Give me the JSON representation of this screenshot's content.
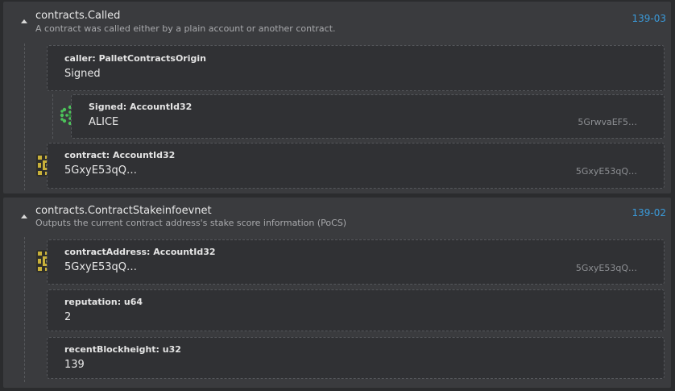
{
  "events": [
    {
      "title": "contracts.Called",
      "description": "A contract was called either by a plain account or another contract.",
      "link": "139-03",
      "params": [
        {
          "label": "caller: PalletContractsOrigin",
          "value": "Signed"
        },
        {
          "label": "Signed: AccountId32",
          "value": "ALICE",
          "address": "5GrwvaEF5…",
          "icon": "identicon-green"
        },
        {
          "label": "contract: AccountId32",
          "value": "5GxyE53qQ…",
          "address": "5GxyE53qQ…",
          "icon": "identicon-gold"
        }
      ]
    },
    {
      "title": "contracts.ContractStakeinfoevnet",
      "description": "Outputs the current contract address's stake score information (PoCS)",
      "link": "139-02",
      "params": [
        {
          "label": "contractAddress: AccountId32",
          "value": "5GxyE53qQ…",
          "address": "5GxyE53qQ…",
          "icon": "identicon-gold"
        },
        {
          "label": "reputation: u64",
          "value": "2"
        },
        {
          "label": "recentBlockheight: u32",
          "value": "139"
        }
      ]
    }
  ],
  "colors": {
    "background": "#2b2c2e",
    "panel": "#3a3b3e",
    "link": "#3a9ad9",
    "identicon_green": "#4cc35a",
    "identicon_gold": "#c9b13a"
  }
}
